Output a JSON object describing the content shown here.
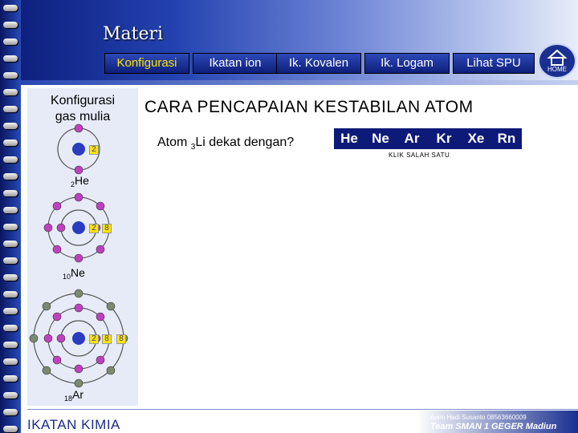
{
  "header": {
    "title": "Materi"
  },
  "nav": {
    "tabs": [
      {
        "label": "Konfigurasi",
        "active": true
      },
      {
        "label": "Ikatan ion",
        "active": false
      },
      {
        "label": "Ik. Kovalen",
        "active": false
      },
      {
        "label": "Ik.  Logam",
        "active": false
      },
      {
        "label": "Lihat SPU",
        "active": false
      }
    ],
    "home_label": "HOME"
  },
  "sidebar": {
    "title_line1": "Konfigurasi",
    "title_line2": "gas mulia",
    "atoms": [
      {
        "number": "2",
        "symbol": "He",
        "shells": [
          "2"
        ]
      },
      {
        "number": "10",
        "symbol": "Ne",
        "shells": [
          "2",
          "8"
        ]
      },
      {
        "number": "18",
        "symbol": "Ar",
        "shells": [
          "2",
          "8",
          "8"
        ]
      }
    ]
  },
  "main": {
    "heading": "CARA PENCAPAIAN KESTABILAN ATOM",
    "question_prefix": "Atom ",
    "question_sub": "3",
    "question_suffix": "Li dekat dengan?",
    "choices": [
      "He",
      "Ne",
      "Ar",
      "Kr",
      "Xe",
      "Rn"
    ],
    "hint": "KLIK SALAH SATU"
  },
  "footer": {
    "left": "IKATAN KIMIA",
    "credit": "Anim Hadi Susanto 08563660009",
    "team": "Team SMAN 1 GEGER Madiun"
  },
  "colors": {
    "header_dark": "#0b1c78",
    "active_tab": "#ffe400",
    "nucleus": "#2a3cc0",
    "electron_inner": "#c040c0",
    "electron_outer": "#7a8a70"
  }
}
